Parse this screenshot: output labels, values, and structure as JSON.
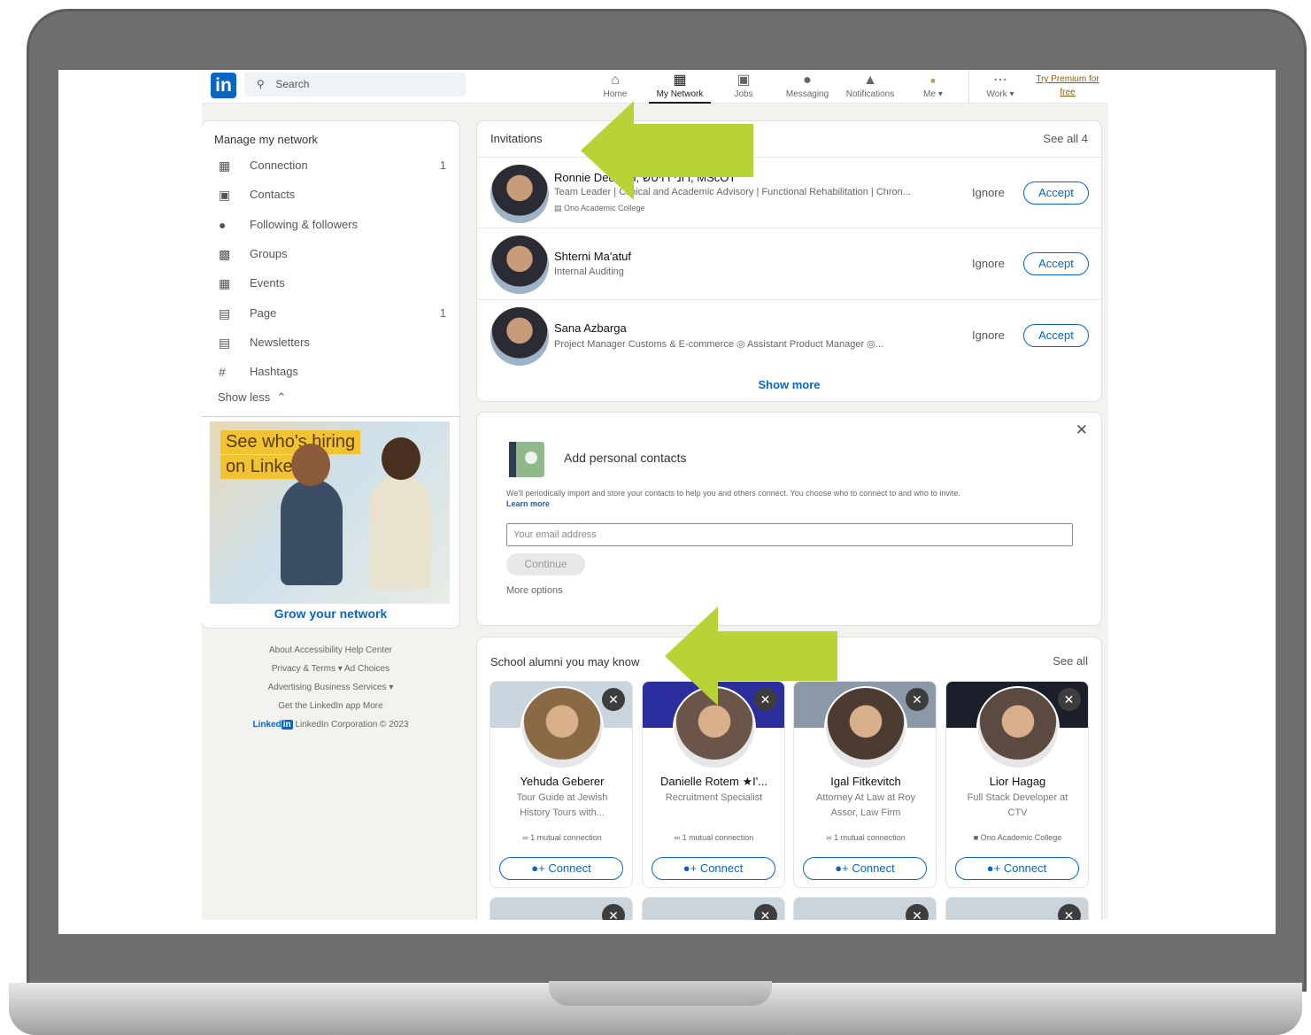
{
  "nav": {
    "search_placeholder": "Search",
    "items": [
      {
        "label": "Home",
        "icon": "home-icon"
      },
      {
        "label": "My Network",
        "icon": "network-icon"
      },
      {
        "label": "Jobs",
        "icon": "briefcase-icon"
      },
      {
        "label": "Messaging",
        "icon": "chat-icon"
      },
      {
        "label": "Notifications",
        "icon": "bell-icon"
      },
      {
        "label": "Me",
        "icon": "avatar-icon"
      },
      {
        "label": "Work",
        "icon": "grid-icon"
      }
    ],
    "premium": "Try Premium for free",
    "active": "My Network"
  },
  "manage": {
    "title": "Manage my network",
    "items": [
      {
        "label": "Connection",
        "count": "1",
        "icon": "people-icon"
      },
      {
        "label": "Contacts",
        "count": "",
        "icon": "contact-card-icon"
      },
      {
        "label": "Following & followers",
        "count": "",
        "icon": "person-icon"
      },
      {
        "label": "Groups",
        "count": "",
        "icon": "groups-icon"
      },
      {
        "label": "Events",
        "count": "",
        "icon": "calendar-icon"
      },
      {
        "label": "Page",
        "count": "1",
        "icon": "building-icon"
      },
      {
        "label": "Newsletters",
        "count": "",
        "icon": "newspaper-icon"
      },
      {
        "label": "Hashtags",
        "count": "",
        "icon": "hashtag-icon"
      }
    ],
    "show_less": "Show less"
  },
  "ad": {
    "line1": "See who's hiring",
    "line2": "on LinkedIn.",
    "cta": "Grow your network"
  },
  "footer": {
    "row1": "About   Accessibility   Help Center",
    "row2": "Privacy & Terms ▾   Ad Choices",
    "row3": "Advertising   Business Services ▾",
    "row4": "Get the LinkedIn app   More",
    "brand": "Linked",
    "brand_in": "in",
    "copyright": "LinkedIn Corporation © 2023"
  },
  "invitations": {
    "title": "Invitations",
    "see_all": "See all 4",
    "ignore_label": "Ignore",
    "accept_label": "Accept",
    "items": [
      {
        "name": "Ronnie Deutsch, רוני דויטש, MScOT",
        "headline": "Team Leader | Clinical and Academic Advisory | Functional Rehabilitation | Chron...",
        "org": "Ono Academic College"
      },
      {
        "name": "Shterni Ma'atuf",
        "headline": "Internal Auditing",
        "org": ""
      },
      {
        "name": "Sana Azbarga",
        "headline": "Project Manager Customs & E-commerce ◎ Assistant Product Manager ◎...",
        "org": ""
      }
    ],
    "show_more": "Show more"
  },
  "add_contacts": {
    "title": "Add personal contacts",
    "description": "We'll periodically import and store your contacts to help you and others connect. You choose who to connect to and who to invite.",
    "learn_more": "Learn more",
    "email_placeholder": "Your email address",
    "continue": "Continue",
    "more_options": "More options"
  },
  "alumni": {
    "title": "School alumni you may know",
    "see_all": "See all",
    "connect_label": "Connect",
    "people": [
      {
        "name": "Yehuda Geberer",
        "headline": "Tour Guide at Jewish History Tours with...",
        "meta": "1 mutual connection",
        "cover": "#c9d6df",
        "avatar": "#8a6a45"
      },
      {
        "name": "Danielle Rotem ★I'...",
        "headline": "Recruitment Specialist",
        "meta": "1 mutual connection",
        "cover": "#2b2f9e",
        "avatar": "#6b5548"
      },
      {
        "name": "Igal Fitkevitch",
        "headline": "Attorney At Law at Roy Assor, Law Firm",
        "meta": "1 mutual connection",
        "cover": "#8a98a8",
        "avatar": "#4b3b30"
      },
      {
        "name": "Lior Hagag",
        "headline": "Full Stack Developer at CTV",
        "meta": "Ono Academic College",
        "cover": "#1b1f2a",
        "avatar": "#5a4a40"
      }
    ]
  },
  "colors": {
    "accent": "#0a66c2",
    "arrow": "#b8d335",
    "premium": "#915907"
  }
}
